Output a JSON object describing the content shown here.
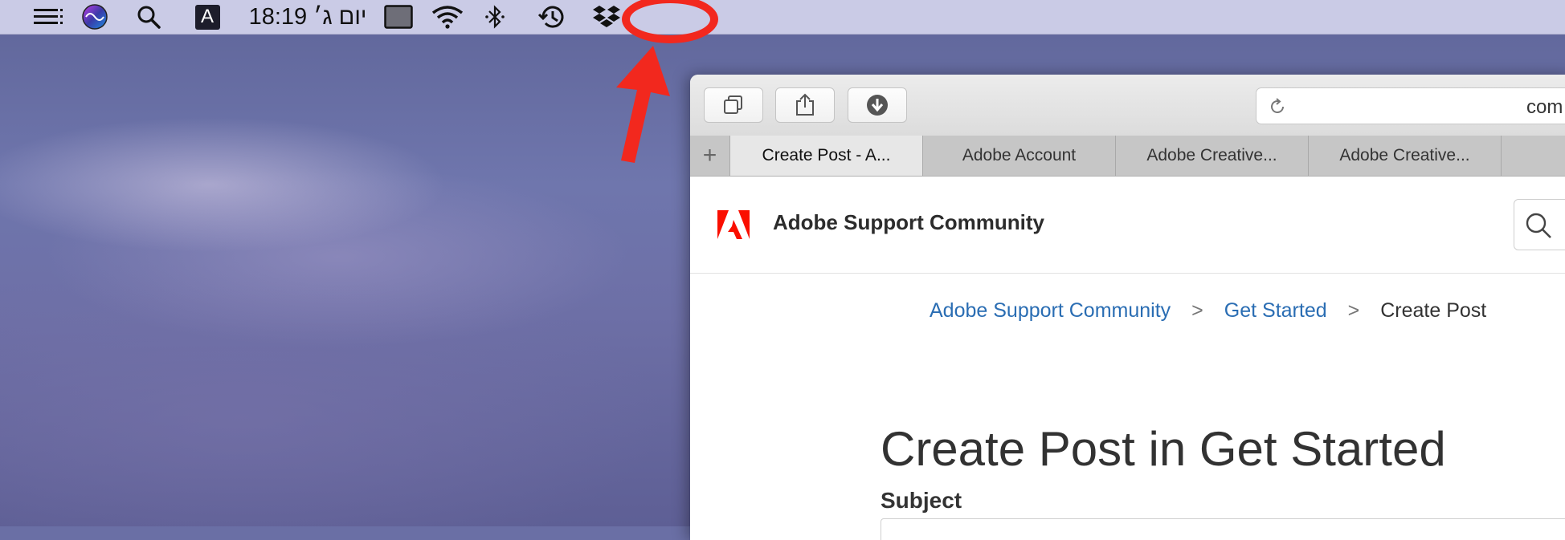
{
  "menubar": {
    "time_label": "18:19 יום ג׳",
    "text_input_indicator": "A",
    "icons": [
      "menu-list-icon",
      "siri-icon",
      "search-icon",
      "display-icon",
      "wifi-icon",
      "bluetooth-icon",
      "time-machine-icon",
      "dropbox-icon"
    ]
  },
  "annotation": {
    "color": "#f2281e"
  },
  "browser": {
    "address_text": "com",
    "toolbar_icons": [
      "tabs-overview-icon",
      "share-icon",
      "downloads-icon",
      "reload-icon"
    ],
    "tabs": [
      {
        "label": "Create Post - A...",
        "active": true
      },
      {
        "label": "Adobe Account",
        "active": false
      },
      {
        "label": "Adobe Creative...",
        "active": false
      },
      {
        "label": "Adobe Creative...",
        "active": false
      }
    ]
  },
  "page": {
    "site_title": "Adobe Support Community",
    "breadcrumb": {
      "items": [
        "Adobe Support Community",
        "Get Started",
        "Create Post"
      ],
      "separator": ">"
    },
    "title": "Create Post in Get Started",
    "subject_label": "Subject",
    "brand_color": "#fa0f00",
    "link_color": "#2a6db3"
  }
}
